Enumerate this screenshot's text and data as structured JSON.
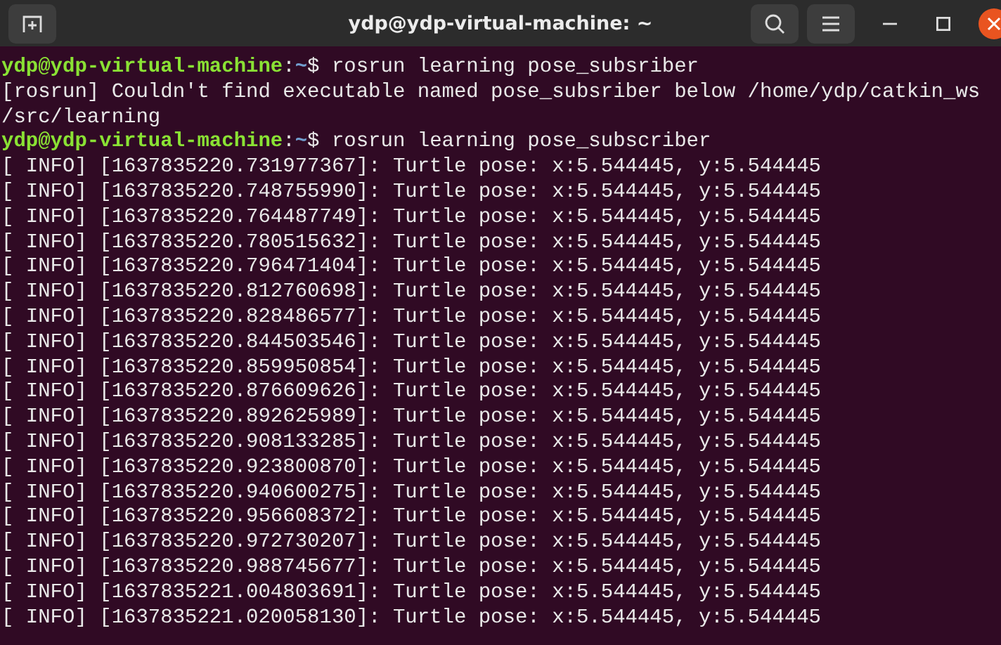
{
  "window": {
    "title": "ydp@ydp-virtual-machine: ~"
  },
  "terminal": {
    "lines": [
      {
        "kind": "prompt",
        "user": "ydp@ydp-virtual-machine",
        "separator": ":",
        "path": "~",
        "symbol": "$",
        "command": " rosrun learning pose_subsriber"
      },
      {
        "kind": "output",
        "text": "[rosrun] Couldn't find executable named pose_subsriber below /home/ydp/catkin_ws"
      },
      {
        "kind": "output",
        "text": "/src/learning"
      },
      {
        "kind": "prompt",
        "user": "ydp@ydp-virtual-machine",
        "separator": ":",
        "path": "~",
        "symbol": "$",
        "command": " rosrun learning pose_subscriber"
      },
      {
        "kind": "output",
        "text": "[ INFO] [1637835220.731977367]: Turtle pose: x:5.544445, y:5.544445"
      },
      {
        "kind": "output",
        "text": "[ INFO] [1637835220.748755990]: Turtle pose: x:5.544445, y:5.544445"
      },
      {
        "kind": "output",
        "text": "[ INFO] [1637835220.764487749]: Turtle pose: x:5.544445, y:5.544445"
      },
      {
        "kind": "output",
        "text": "[ INFO] [1637835220.780515632]: Turtle pose: x:5.544445, y:5.544445"
      },
      {
        "kind": "output",
        "text": "[ INFO] [1637835220.796471404]: Turtle pose: x:5.544445, y:5.544445"
      },
      {
        "kind": "output",
        "text": "[ INFO] [1637835220.812760698]: Turtle pose: x:5.544445, y:5.544445"
      },
      {
        "kind": "output",
        "text": "[ INFO] [1637835220.828486577]: Turtle pose: x:5.544445, y:5.544445"
      },
      {
        "kind": "output",
        "text": "[ INFO] [1637835220.844503546]: Turtle pose: x:5.544445, y:5.544445"
      },
      {
        "kind": "output",
        "text": "[ INFO] [1637835220.859950854]: Turtle pose: x:5.544445, y:5.544445"
      },
      {
        "kind": "output",
        "text": "[ INFO] [1637835220.876609626]: Turtle pose: x:5.544445, y:5.544445"
      },
      {
        "kind": "output",
        "text": "[ INFO] [1637835220.892625989]: Turtle pose: x:5.544445, y:5.544445"
      },
      {
        "kind": "output",
        "text": "[ INFO] [1637835220.908133285]: Turtle pose: x:5.544445, y:5.544445"
      },
      {
        "kind": "output",
        "text": "[ INFO] [1637835220.923800870]: Turtle pose: x:5.544445, y:5.544445"
      },
      {
        "kind": "output",
        "text": "[ INFO] [1637835220.940600275]: Turtle pose: x:5.544445, y:5.544445"
      },
      {
        "kind": "output",
        "text": "[ INFO] [1637835220.956608372]: Turtle pose: x:5.544445, y:5.544445"
      },
      {
        "kind": "output",
        "text": "[ INFO] [1637835220.972730207]: Turtle pose: x:5.544445, y:5.544445"
      },
      {
        "kind": "output",
        "text": "[ INFO] [1637835220.988745677]: Turtle pose: x:5.544445, y:5.544445"
      },
      {
        "kind": "output",
        "text": "[ INFO] [1637835221.004803691]: Turtle pose: x:5.544445, y:5.544445"
      },
      {
        "kind": "output",
        "text": "[ INFO] [1637835221.020058130]: Turtle pose: x:5.544445, y:5.544445"
      }
    ]
  }
}
